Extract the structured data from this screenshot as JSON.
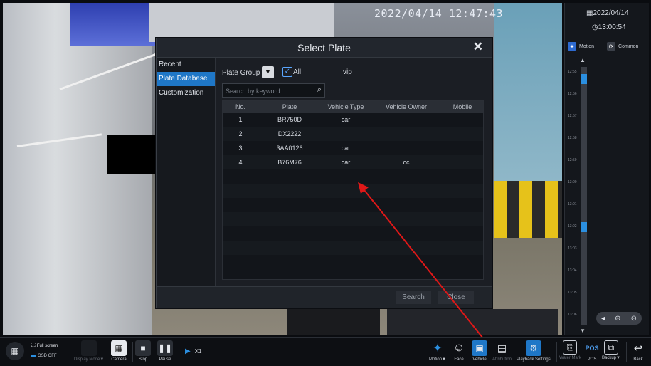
{
  "video": {
    "timestamp": "2022/04/14  12:47:43"
  },
  "right_panel": {
    "date": "2022/04/14",
    "time": "13:00:54",
    "legend": [
      "Motion",
      "Common"
    ],
    "time_ticks": [
      "12:55",
      "12:56",
      "12:57",
      "12:58",
      "12:59",
      "13:00",
      "13:01",
      "13:02",
      "13:03",
      "13:04",
      "13:05",
      "13:06"
    ],
    "zoom_icons": [
      "zoom-out-icon",
      "zoom-in-icon",
      "zoom-reset-icon"
    ]
  },
  "dialog": {
    "title": "Select Plate",
    "close": "✕",
    "sidebar": [
      "Recent",
      "Plate Database",
      "Customization"
    ],
    "plate_group_label": "Plate Group",
    "all_label": "All",
    "group_name": "vip",
    "search_placeholder": "Search by keyword",
    "columns": [
      "No.",
      "Plate",
      "Vehicle Type",
      "Vehicle Owner",
      "Mobile"
    ],
    "rows": [
      {
        "no": "1",
        "plate": "BR750D",
        "type": "car",
        "owner": "",
        "mobile": ""
      },
      {
        "no": "2",
        "plate": "DX2222",
        "type": "",
        "owner": "",
        "mobile": ""
      },
      {
        "no": "3",
        "plate": "3AA0126",
        "type": "car",
        "owner": "",
        "mobile": ""
      },
      {
        "no": "4",
        "plate": "B76M76",
        "type": "car",
        "owner": "cc",
        "mobile": ""
      }
    ],
    "search_button": "Search",
    "close_button": "Close"
  },
  "toolbar": {
    "full_screen": "Full screen",
    "osd_off": "OSD OFF",
    "display_mode": "Display Mode▼",
    "camera": "Camera",
    "stop": "Stop",
    "pause": "Pause",
    "speed": "X1",
    "motion": "Motion▼",
    "face": "Face",
    "vehicle": "Vehicle",
    "attribution": "Attribution",
    "playback_settings": "Playback Settings",
    "water_mark": "Water Mark",
    "pos": "POS",
    "pos_icon_text": "POS",
    "backup": "Backup▼",
    "back": "Back"
  },
  "colors": {
    "accent": "#1f77c7",
    "annotation_arrow": "#e01818"
  }
}
